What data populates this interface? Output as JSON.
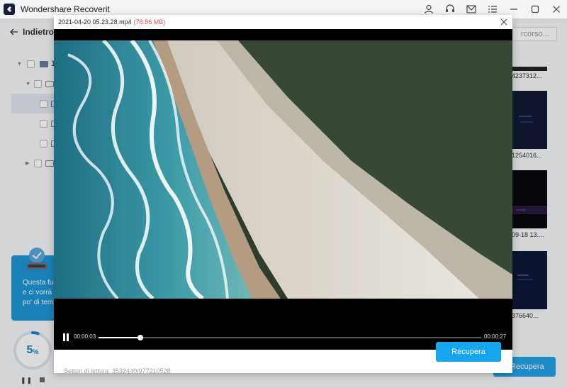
{
  "app": {
    "title": "Wondershare Recoverit"
  },
  "titlebar_icons": [
    "user-icon",
    "headset-icon",
    "mail-icon",
    "menu-list-icon",
    "minimize-icon",
    "maximize-icon",
    "close-icon"
  ],
  "toolbar": {
    "back_label": "Indietro",
    "search_placeholder": "rcorso..."
  },
  "tree": {
    "drive_label": "1"
  },
  "thumbnails": [
    {
      "caption": "4237312..."
    },
    {
      "caption": "1254016..."
    },
    {
      "caption": "09-18 13...."
    },
    {
      "caption": "376640..."
    }
  ],
  "tooltip": {
    "lines": [
      "Questa fu",
      "e ci vorrà",
      "po' di tem"
    ]
  },
  "progress": {
    "percent_text": "5",
    "percent_symbol": "%",
    "value": 0.05,
    "color": "#1e80c8"
  },
  "bottom_status": "Settori di lettura: 3532440/977210528",
  "background_recover_label": "Recupera",
  "preview": {
    "filename": "2021-04-20 05.23.28.mp4",
    "size": "(78.86 MB)",
    "current_time": "00:00:03",
    "total_time": "00:00:27",
    "progress_fraction": 0.11,
    "recover_label": "Recupera"
  },
  "colors": {
    "accent": "#16a5ee",
    "size_text": "#e05050",
    "tooltip_bg": "#1d97d6"
  }
}
